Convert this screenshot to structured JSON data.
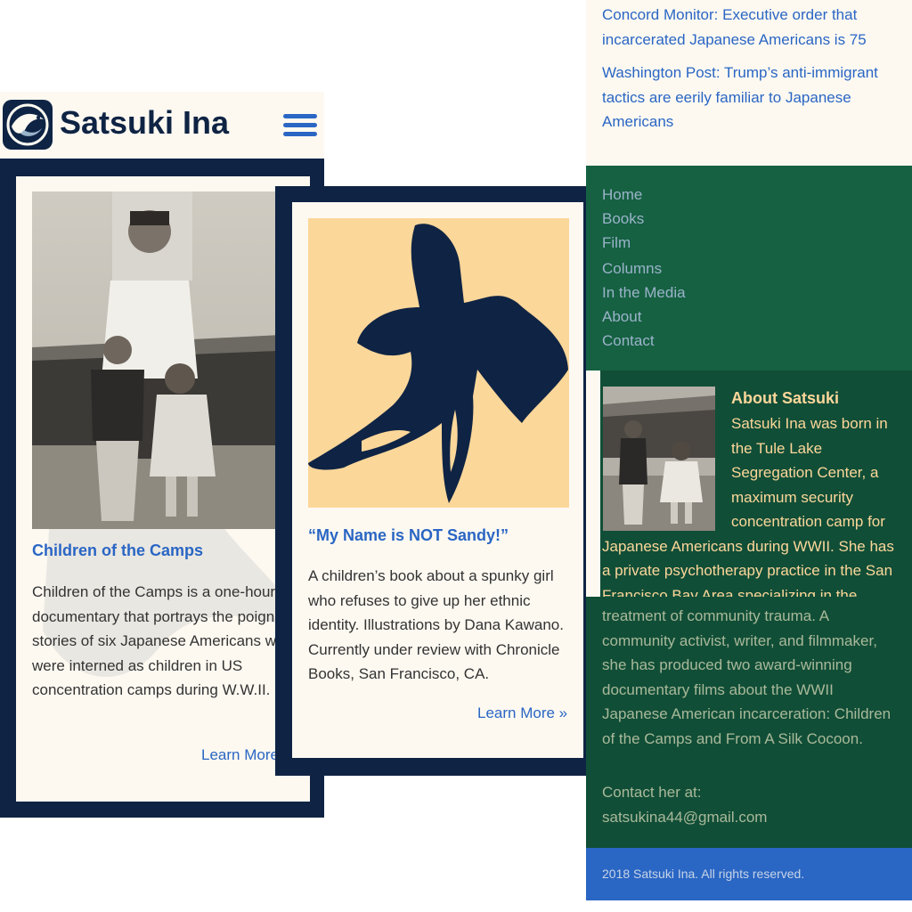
{
  "header": {
    "site_title": "Satsuki Ina",
    "menu_icon": "hamburger-menu-icon"
  },
  "film_card": {
    "title": "Children of the Camps",
    "description": "Children of the Camps is a one-hour documentary that portrays the poignant stories of six Japanese Americans who were interned as children in US concentration camps during W.W.II.",
    "learn_more": "Learn More »"
  },
  "book_card": {
    "title": "“My Name is NOT Sandy!”",
    "description": "A children’s book about a spunky girl who refuses to give up her ethnic identity. Illustrations by Dana Kawano. Currently under review with Chronicle Books, San Francisco, CA.",
    "learn_more": "Learn More »"
  },
  "media_links": [
    "Concord Monitor: Executive order that incarcerated Japanese Americans is 75",
    "Washington Post: Trump’s anti-immigrant tactics are eerily familiar to Japanese Americans"
  ],
  "nav": [
    "Home",
    "Books",
    "Film",
    "Columns",
    "In the Media",
    "About",
    "Contact"
  ],
  "about": {
    "heading": "About Satsuki",
    "text_part1_beside_photo": "Satsuki Ina was born in the Tule Lake Segregation Center, a maximum security concentration camp for",
    "text_part1_full": "Japanese Americans during WWII. She has a private psychotherapy practice in the San Francisco Bay Area specializing in the",
    "text_part2": "treatment of community trauma. A community activist, writer, and filmmaker, she has produced two award-winning documentary films about the WWII Japanese American incarceration: Children of the Camps and From A Silk Cocoon.",
    "contact_label": "Contact her at:",
    "contact_email": "satsukina44@gmail.com"
  },
  "footer": {
    "copyright": "2018 Satsuki Ina. All rights reserved."
  },
  "colors": {
    "navy": "#0f2444",
    "cream": "#fdf9f1",
    "link_blue": "#2a66c4",
    "green": "#156142",
    "dark_green": "#114e37",
    "peach": "#fcd79a"
  }
}
